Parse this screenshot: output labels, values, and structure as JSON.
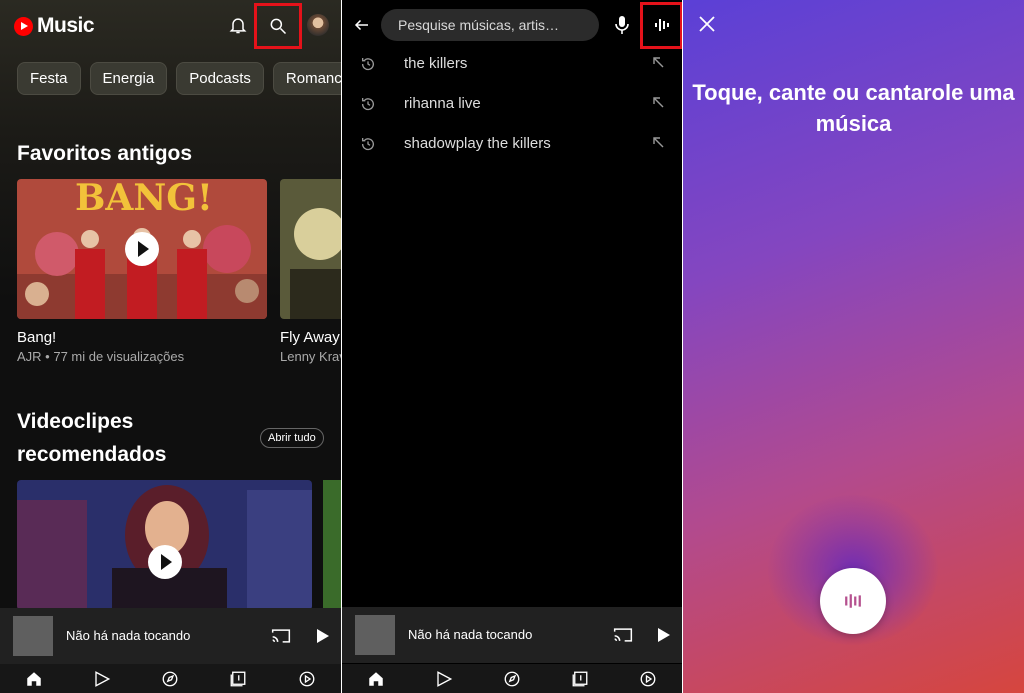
{
  "panel1": {
    "app_name": "Music",
    "chips": [
      "Festa",
      "Energia",
      "Podcasts",
      "Romance"
    ],
    "section1_title": "Favoritos antigos",
    "card1": {
      "thumb_text": "BANG!",
      "title": "Bang!",
      "subtitle": "AJR • 77 mi de visualizações"
    },
    "card2": {
      "title": "Fly Away",
      "subtitle": "Lenny Krav"
    },
    "section2_title_line1": "Videoclipes",
    "section2_title_line2": "recomendados",
    "see_all_label": "Abrir tudo",
    "player_text": "Não há nada tocando"
  },
  "panel2": {
    "search_placeholder": "Pesquise músicas, artis…",
    "history": [
      "the killers",
      "rihanna live",
      "shadowplay the killers"
    ],
    "player_text": "Não há nada tocando"
  },
  "panel3": {
    "prompt_line1": "Toque, cante ou cantarole uma",
    "prompt_line2": "música"
  },
  "nav_icons": [
    "home-icon",
    "samples-icon",
    "explore-icon",
    "library-icon",
    "upgrade-icon"
  ],
  "colors": {
    "accent_red": "#e5121a",
    "youtube_red": "#ff0000",
    "player_bg": "#212121"
  }
}
